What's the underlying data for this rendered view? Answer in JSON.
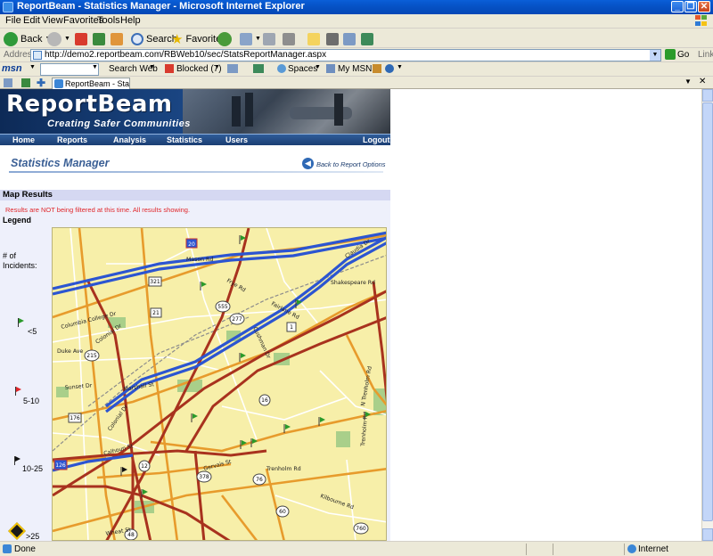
{
  "window": {
    "title": "ReportBeam - Statistics Manager - Microsoft Internet Explorer"
  },
  "menu": [
    "File",
    "Edit",
    "View",
    "Favorites",
    "Tools",
    "Help"
  ],
  "toolbar": {
    "back_label": "Back",
    "search_label": "Search",
    "favorites_label": "Favorites"
  },
  "address": {
    "label": "Address",
    "url": "http://demo2.reportbeam.com/RBWeb10/sec/StatsReportManager.aspx",
    "go_label": "Go",
    "links_label": "Links"
  },
  "msnbar": {
    "logo": "msn",
    "search_web": "Search Web",
    "blocked": "Blocked (7)",
    "spaces": "Spaces",
    "my_msn": "My MSN"
  },
  "tab": {
    "title": "ReportBeam - Statist..."
  },
  "site": {
    "logo": "ReportBeam",
    "tagline": "Creating Safer Communities",
    "nav": [
      "Home",
      "Reports",
      "Analysis",
      "Statistics",
      "Users",
      "Logout"
    ]
  },
  "page": {
    "title": "Statistics Manager",
    "back_link": "Back to Report Options",
    "section_title": "Map Results",
    "notice": "Results are NOT being filtered at this time. All results showing.",
    "legend_title": "Legend",
    "incidents_label": [
      "# of",
      "Incidents:"
    ],
    "legend_items": [
      {
        "label": "<5",
        "color": "#2a9a2a"
      },
      {
        "label": "5-10",
        "color": "#e0262a"
      },
      {
        "label": "10-25",
        "color": "#111111"
      },
      {
        "label": ">25",
        "color": "#f2c200"
      }
    ]
  },
  "map": {
    "labels": {
      "mason": "Mason Rd",
      "frye": "Frye Rd",
      "fairlane": "Fairlane Rd",
      "claudia": "Claudia Dr",
      "shakespeare": "Shakespeare Rd",
      "columbia_college": "Columbia College Dr",
      "colonial": "Colonial Dr",
      "duke": "Duke Ave",
      "sunset": "Sunset Dr",
      "marshall": "Marshall St",
      "colonial2": "Colonial Dr",
      "cushman": "Cushman Dr",
      "trenholm_n": "N Trenholm Rd",
      "trenholm": "Trenholm Rd",
      "calhoun": "Calhoun St",
      "gervais": "Gervais St",
      "trenholm2": "Trenholm Rd",
      "kilbourne": "Kilbourne Rd",
      "wheat": "Wheat St"
    },
    "shields": [
      "20",
      "321",
      "21",
      "555",
      "277",
      "1",
      "215",
      "16",
      "12",
      "176",
      "126",
      "378",
      "76",
      "48",
      "760",
      "60"
    ]
  },
  "status": {
    "text": "Done",
    "zone": "Internet"
  }
}
